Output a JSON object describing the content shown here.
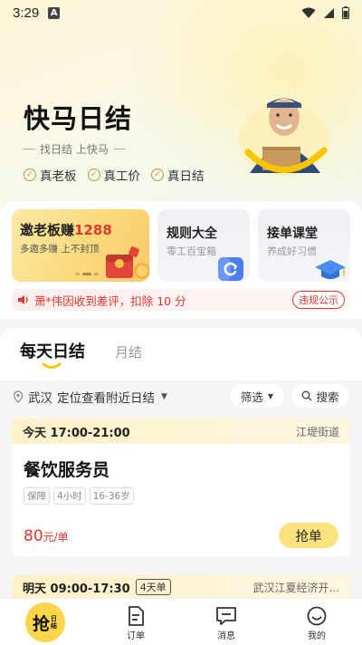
{
  "status_bar": {
    "time": "3:29",
    "notification_letter": "A"
  },
  "brand": {
    "title": "快马日结",
    "subtitle": "找日结 上快马",
    "badges": [
      "真老板",
      "真工价",
      "真日结"
    ]
  },
  "promo": {
    "invite": {
      "title_prefix": "邀老板赚",
      "title_amount": "1288",
      "subtitle": "多邀多赚 上不封顶"
    },
    "rules": {
      "title": "规则大全",
      "subtitle": "零工百宝箱"
    },
    "class": {
      "title": "接单课堂",
      "subtitle": "养成好习惯"
    },
    "notice": {
      "text": "萧*伟因收到差评，扣除 10 分",
      "button": "违规公示"
    }
  },
  "tabs": {
    "daily": "每天日结",
    "monthly": "月结"
  },
  "filter": {
    "city": "武汉",
    "location_prompt": "定位查看附近日结",
    "filter_label": "筛选",
    "search_label": "搜索"
  },
  "jobs": [
    {
      "time": "今天 17:00-21:00",
      "location": "江堤街道",
      "title": "餐饮服务员",
      "tags": [
        "保障",
        "4小时",
        "16-36岁"
      ],
      "price": "80",
      "price_unit": "元/单",
      "action": "抢单"
    },
    {
      "time": "明天 09:00-17:30",
      "days": "4天单",
      "location": "武汉江夏经济开..."
    }
  ],
  "bottom_nav": {
    "main_big": "抢",
    "main_small": "日结",
    "orders": "订单",
    "messages": "消息",
    "mine": "我的"
  },
  "colors": {
    "accent_yellow": "#fbd64a",
    "accent_red": "#e0382f"
  }
}
